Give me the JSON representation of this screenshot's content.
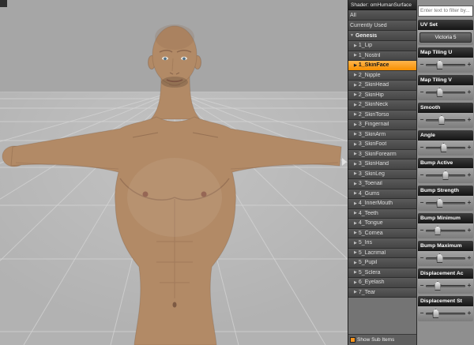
{
  "colors": {
    "selection_orange": "#f78f00",
    "checkbox_orange": "#f7941d",
    "skin_tone": "#b28a66",
    "viewport_bg": "#a9a9a9"
  },
  "viewport": {
    "collapse_arrow_icon": "panel-collapse-arrow"
  },
  "surface_panel": {
    "shader_header": "Shader: omHumanSurface",
    "filters": [
      {
        "label": "All"
      },
      {
        "label": "Currently Used"
      }
    ],
    "group": {
      "label": "Genesis",
      "arrow": "▼"
    },
    "item_arrow": "▶",
    "items": [
      {
        "label": "1_Lip",
        "selected": false
      },
      {
        "label": "1_Nostril",
        "selected": false
      },
      {
        "label": "1_SkinFace",
        "selected": true
      },
      {
        "label": "2_Nipple",
        "selected": false
      },
      {
        "label": "2_SkinHead",
        "selected": false
      },
      {
        "label": "2_SkinHip",
        "selected": false
      },
      {
        "label": "2_SkinNeck",
        "selected": false
      },
      {
        "label": "2_SkinTorso",
        "selected": false
      },
      {
        "label": "3_Fingernail",
        "selected": false
      },
      {
        "label": "3_SkinArm",
        "selected": false
      },
      {
        "label": "3_SkinFoot",
        "selected": false
      },
      {
        "label": "3_SkinForearm",
        "selected": false
      },
      {
        "label": "3_SkinHand",
        "selected": false
      },
      {
        "label": "3_SkinLeg",
        "selected": false
      },
      {
        "label": "3_Toenail",
        "selected": false
      },
      {
        "label": "4_Gums",
        "selected": false
      },
      {
        "label": "4_InnerMouth",
        "selected": false
      },
      {
        "label": "4_Teeth",
        "selected": false
      },
      {
        "label": "4_Tongue",
        "selected": false
      },
      {
        "label": "5_Cornea",
        "selected": false
      },
      {
        "label": "5_Iris",
        "selected": false
      },
      {
        "label": "5_Lacrimal",
        "selected": false
      },
      {
        "label": "5_Pupil",
        "selected": false
      },
      {
        "label": "5_Sclera",
        "selected": false
      },
      {
        "label": "6_Eyelash",
        "selected": false
      },
      {
        "label": "7_Tear",
        "selected": false
      }
    ],
    "footer": {
      "label": "Show Sub Items",
      "checked": true
    }
  },
  "properties_panel": {
    "filter_placeholder": "Enter text to filter by...",
    "properties": [
      {
        "label": "UV Set",
        "type": "select",
        "value": "Victoria 5"
      },
      {
        "label": "Map Tiling U",
        "type": "slider",
        "thumb": 0.35
      },
      {
        "label": "Map Tiling V",
        "type": "slider",
        "thumb": 0.35
      },
      {
        "label": "Smooth",
        "type": "slider",
        "thumb": 0.4
      },
      {
        "label": "Angle",
        "type": "slider",
        "thumb": 0.45
      },
      {
        "label": "Bump Active",
        "type": "slider",
        "thumb": 0.5
      },
      {
        "label": "Bump Strength",
        "type": "slider",
        "thumb": 0.35
      },
      {
        "label": "Bump Minimum",
        "type": "slider",
        "thumb": 0.3
      },
      {
        "label": "Bump Maximum",
        "type": "slider",
        "thumb": 0.35
      },
      {
        "label": "Displacement Ac",
        "type": "slider",
        "thumb": 0.3
      },
      {
        "label": "Displacement St",
        "type": "slider",
        "thumb": 0.25
      }
    ]
  }
}
